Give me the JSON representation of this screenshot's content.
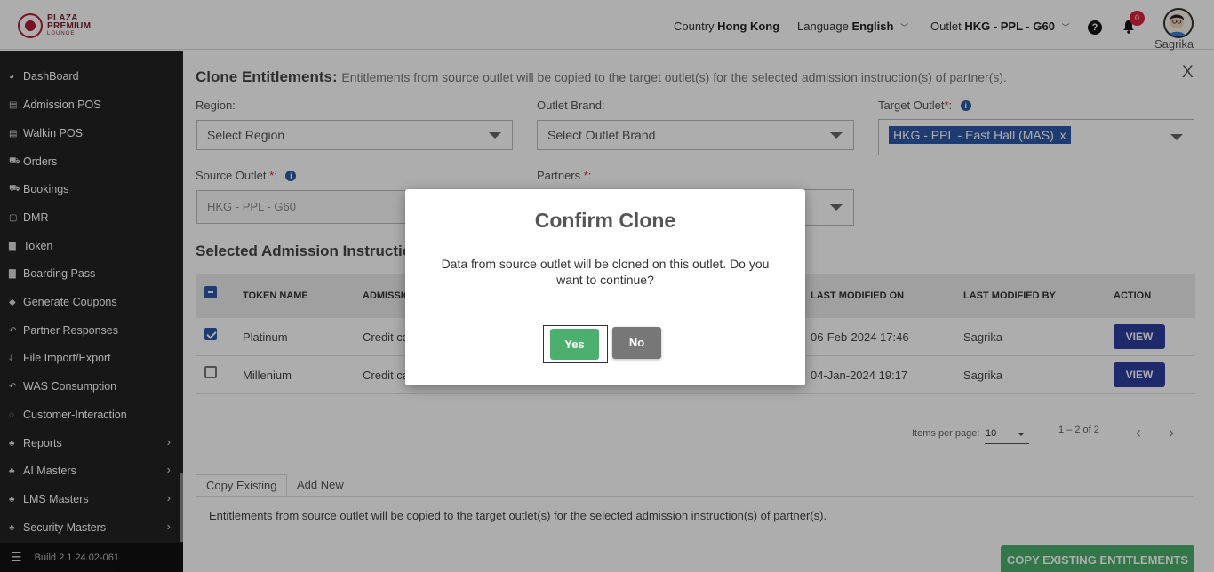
{
  "header": {
    "logo_line1": "PLAZA",
    "logo_line2": "PREMIUM",
    "logo_line3": "LOUNGE",
    "country_label": "Country",
    "country_value": "Hong Kong",
    "language_label": "Language",
    "language_value": "English",
    "outlet_label": "Outlet",
    "outlet_value": "HKG - PPL - G60",
    "notification_count": "0",
    "user_name": "Sagrika"
  },
  "sidebar": {
    "items": [
      {
        "label": "DashBoard",
        "icon": "dashboard-icon"
      },
      {
        "label": "Admission POS",
        "icon": "id-card-icon"
      },
      {
        "label": "Walkin POS",
        "icon": "id-card-icon"
      },
      {
        "label": "Orders",
        "icon": "cart-icon"
      },
      {
        "label": "Bookings",
        "icon": "cart-icon"
      },
      {
        "label": "DMR",
        "icon": "calendar-icon"
      },
      {
        "label": "Token",
        "icon": "file-icon"
      },
      {
        "label": "Boarding Pass",
        "icon": "file-icon"
      },
      {
        "label": "Generate Coupons",
        "icon": "tag-icon"
      },
      {
        "label": "Partner Responses",
        "icon": "reply-icon"
      },
      {
        "label": "File Import/Export",
        "icon": "download-icon"
      },
      {
        "label": "WAS Consumption",
        "icon": "reply-icon"
      },
      {
        "label": "Customer-Interaction",
        "icon": "chat-icon"
      },
      {
        "label": "Reports",
        "icon": "sitemap-icon",
        "expandable": true
      },
      {
        "label": "AI Masters",
        "icon": "sitemap-icon",
        "expandable": true
      },
      {
        "label": "LMS Masters",
        "icon": "sitemap-icon",
        "expandable": true
      },
      {
        "label": "Security Masters",
        "icon": "sitemap-icon",
        "expandable": true
      }
    ],
    "build": "Build 2.1.24.02-061"
  },
  "page": {
    "title": "Clone Entitlements:",
    "subtitle": "Entitlements from source outlet will be copied to the target outlet(s) for the selected admission instruction(s) of partner(s).",
    "close_label": "X",
    "region_label": "Region:",
    "region_placeholder": "Select Region",
    "brand_label": "Outlet Brand:",
    "brand_placeholder": "Select Outlet Brand",
    "target_label": "Target Outlet",
    "target_suffix": ":",
    "target_chip": "HKG - PPL - East Hall (MAS)",
    "target_chip_remove": "x",
    "source_label": "Source Outlet",
    "source_suffix": ":",
    "source_value": "HKG - PPL - G60",
    "partners_label": "Partners",
    "partners_suffix": ":",
    "required_mark": "*",
    "info_glyph": "i",
    "section_title": "Selected Admission Instructions"
  },
  "table": {
    "headers": {
      "token_name": "TOKEN NAME",
      "admission": "ADMISSION INSTRUCTION",
      "last_modified_on": "LAST MODIFIED ON",
      "last_modified_by": "LAST MODIFIED BY",
      "action": "ACTION"
    },
    "rows": [
      {
        "checked": true,
        "token_name": "Platinum",
        "admission": "Credit card",
        "modified_on": "06-Feb-2024 17:46",
        "modified_by": "Sagrika",
        "action": "VIEW"
      },
      {
        "checked": false,
        "token_name": "Millenium",
        "admission": "Credit card",
        "modified_on": "04-Jan-2024 19:17",
        "modified_by": "Sagrika",
        "action": "VIEW"
      }
    ]
  },
  "pagination": {
    "items_per_page_label": "Items per page:",
    "items_per_page_value": "10",
    "range": "1 – 2 of 2",
    "prev": "‹",
    "next": "›"
  },
  "tabs": {
    "copy_existing": "Copy Existing",
    "add_new": "Add New",
    "description": "Entitlements from source outlet will be copied to the target outlet(s) for the selected admission instruction(s) of partner(s).",
    "copy_button": "COPY EXISTING ENTITLEMENTS"
  },
  "modal": {
    "title": "Confirm Clone",
    "message": "Data from source outlet will be cloned on this outlet. Do you want to continue?",
    "yes": "Yes",
    "no": "No"
  },
  "colors": {
    "primary_blue": "#2f3fa0",
    "chip_blue": "#2f59a8",
    "success_green": "#4caf6e",
    "brand_red": "#b31b34",
    "sidebar_bg": "#222222"
  }
}
